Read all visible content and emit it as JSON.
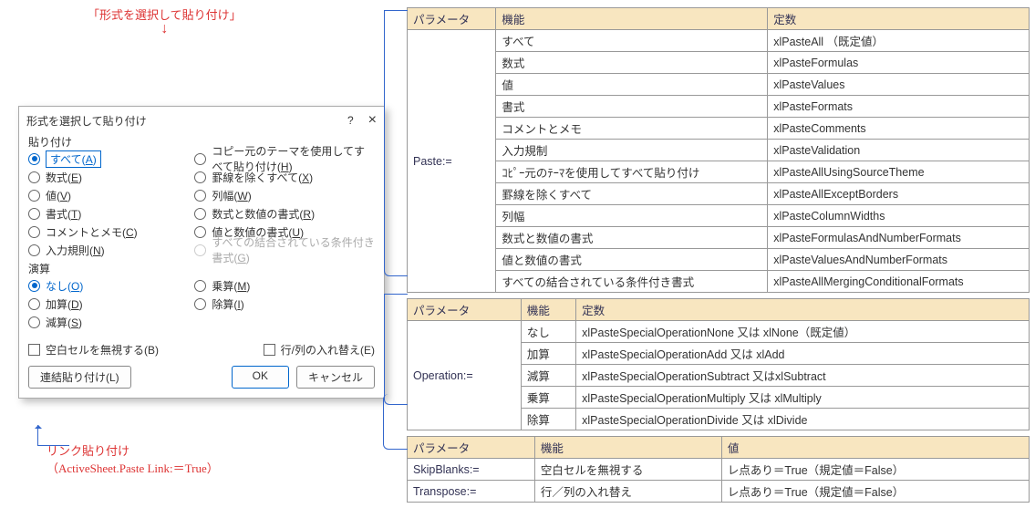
{
  "annotations": {
    "top": "「形式を選択して貼り付け」",
    "bottom_line1": "リンク貼り付け",
    "bottom_line2": "（ActiveSheet.Paste Link:＝True）"
  },
  "dialog": {
    "title": "形式を選択して貼り付け",
    "help_symbol": "?",
    "close_symbol": "×",
    "section_paste": "貼り付け",
    "section_operation": "演算",
    "paste_left": [
      {
        "label": "すべて(A)",
        "selected": true,
        "boxed": true
      },
      {
        "label": "数式(E)"
      },
      {
        "label": "値(V)"
      },
      {
        "label": "書式(T)"
      },
      {
        "label": "コメントとメモ(C)"
      },
      {
        "label": "入力規則(N)"
      }
    ],
    "paste_right": [
      {
        "label": "コピー元のテーマを使用してすべて貼り付け(H)"
      },
      {
        "label": "罫線を除くすべて(X)"
      },
      {
        "label": "列幅(W)"
      },
      {
        "label": "数式と数値の書式(R)"
      },
      {
        "label": "値と数値の書式(U)"
      },
      {
        "label": "すべての結合されている条件付き書式(G)",
        "disabled": true
      }
    ],
    "op_left": [
      {
        "label": "なし(O)",
        "selected": true
      },
      {
        "label": "加算(D)"
      },
      {
        "label": "減算(S)"
      }
    ],
    "op_right": [
      {
        "label": "乗算(M)"
      },
      {
        "label": "除算(I)"
      }
    ],
    "chk_skipblank": "空白セルを無視する(B)",
    "chk_transpose": "行/列の入れ替え(E)",
    "btn_link": "連結貼り付け(L)",
    "btn_ok": "OK",
    "btn_cancel": "キャンセル"
  },
  "table_paste": {
    "headers": [
      "パラメータ",
      "機能",
      "定数"
    ],
    "param": "Paste:=",
    "rows": [
      {
        "func": "すべて",
        "const": "xlPasteAll （既定値）"
      },
      {
        "func": "数式",
        "const": "xlPasteFormulas"
      },
      {
        "func": "値",
        "const": "xlPasteValues"
      },
      {
        "func": "書式",
        "const": "xlPasteFormats"
      },
      {
        "func": "コメントとメモ",
        "const": "xlPasteComments"
      },
      {
        "func": "入力規制",
        "const": "xlPasteValidation"
      },
      {
        "func": "ｺﾋﾟｰ元のﾃｰﾏを使用してすべて貼り付け",
        "const": "xlPasteAllUsingSourceTheme"
      },
      {
        "func": "罫線を除くすべて",
        "const": "xlPasteAllExceptBorders"
      },
      {
        "func": "列幅",
        "const": "xlPasteColumnWidths"
      },
      {
        "func": "数式と数値の書式",
        "const": "xlPasteFormulasAndNumberFormats"
      },
      {
        "func": "値と数値の書式",
        "const": "xlPasteValuesAndNumberFormats"
      },
      {
        "func": "すべての結合されている条件付き書式",
        "const": "xlPasteAllMergingConditionalFormats"
      }
    ]
  },
  "table_op": {
    "headers": [
      "パラメータ",
      "機能",
      "定数"
    ],
    "param": "Operation:=",
    "rows": [
      {
        "func": "なし",
        "const": "xlPasteSpecialOperationNone 又は xlNone（既定値）"
      },
      {
        "func": "加算",
        "const": "xlPasteSpecialOperationAdd 又は xlAdd"
      },
      {
        "func": "減算",
        "const": "xlPasteSpecialOperationSubtract 又はxlSubtract"
      },
      {
        "func": "乗算",
        "const": "xlPasteSpecialOperationMultiply 又は xlMultiply"
      },
      {
        "func": "除算",
        "const": "xlPasteSpecialOperationDivide 又は xlDivide"
      }
    ]
  },
  "table_other": {
    "headers": [
      "パラメータ",
      "機能",
      "値"
    ],
    "rows": [
      {
        "param": "SkipBlanks:=",
        "func": "空白セルを無視する",
        "val": "レ点あり＝True（規定値＝False）"
      },
      {
        "param": "Transpose:=",
        "func": "行／列の入れ替え",
        "val": "レ点あり＝True（規定値＝False）"
      }
    ]
  }
}
